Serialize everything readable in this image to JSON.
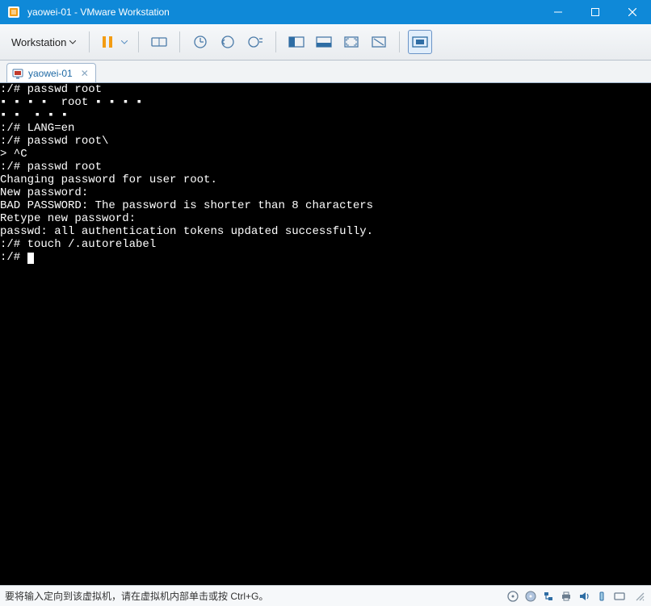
{
  "titlebar": {
    "title": "yaowei-01 - VMware Workstation"
  },
  "toolbar": {
    "menu_label": "Workstation"
  },
  "tabs": {
    "active": {
      "label": "yaowei-01"
    }
  },
  "terminal": {
    "lines": [
      ":/# passwd root",
      "▪ ▪ ▪ ▪  root ▪ ▪ ▪ ▪",
      "▪ ▪  ▪ ▪ ▪",
      ":/# LANG=en",
      ":/# passwd root\\",
      "> ^C",
      ":/# passwd root",
      "Changing password for user root.",
      "New password:",
      "BAD PASSWORD: The password is shorter than 8 characters",
      "Retype new password:",
      "passwd: all authentication tokens updated successfully.",
      ":/# touch /.autorelabel",
      ":/# "
    ]
  },
  "statusbar": {
    "message": "要将输入定向到该虚拟机，请在虚拟机内部单击或按 Ctrl+G。"
  }
}
